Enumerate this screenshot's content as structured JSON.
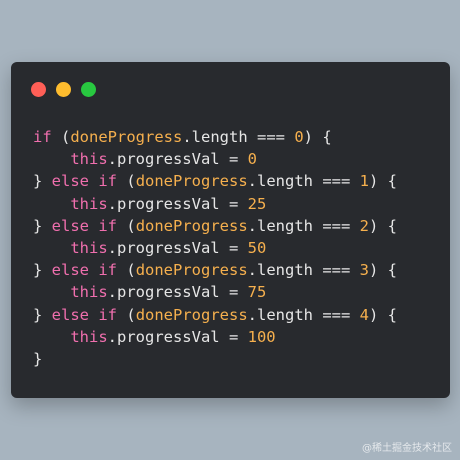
{
  "colors": {
    "background": "#a7b4bf",
    "window": "#282a2e",
    "keyword": "#f06fae",
    "identifier": "#f6b04e",
    "number": "#f6b04e",
    "plain": "#e6e6e6"
  },
  "window_controls": [
    {
      "name": "close-icon",
      "color": "#ff5f57"
    },
    {
      "name": "minimize-icon",
      "color": "#febc2e"
    },
    {
      "name": "maximize-icon",
      "color": "#28c840"
    }
  ],
  "code_lines": [
    {
      "indent": 0,
      "tokens": [
        {
          "t": "if",
          "c": "keyword"
        },
        {
          "t": " (",
          "c": "plain"
        },
        {
          "t": "doneProgress",
          "c": "identifier"
        },
        {
          "t": ".length === ",
          "c": "plain"
        },
        {
          "t": "0",
          "c": "number"
        },
        {
          "t": ") {",
          "c": "plain"
        }
      ]
    },
    {
      "indent": 1,
      "tokens": [
        {
          "t": "this",
          "c": "keyword"
        },
        {
          "t": ".progressVal = ",
          "c": "plain"
        },
        {
          "t": "0",
          "c": "number"
        }
      ]
    },
    {
      "indent": 0,
      "tokens": [
        {
          "t": "} ",
          "c": "plain"
        },
        {
          "t": "else",
          "c": "keyword"
        },
        {
          "t": " ",
          "c": "plain"
        },
        {
          "t": "if",
          "c": "keyword"
        },
        {
          "t": " (",
          "c": "plain"
        },
        {
          "t": "doneProgress",
          "c": "identifier"
        },
        {
          "t": ".length === ",
          "c": "plain"
        },
        {
          "t": "1",
          "c": "number"
        },
        {
          "t": ") {",
          "c": "plain"
        }
      ]
    },
    {
      "indent": 1,
      "tokens": [
        {
          "t": "this",
          "c": "keyword"
        },
        {
          "t": ".progressVal = ",
          "c": "plain"
        },
        {
          "t": "25",
          "c": "number"
        }
      ]
    },
    {
      "indent": 0,
      "tokens": [
        {
          "t": "} ",
          "c": "plain"
        },
        {
          "t": "else",
          "c": "keyword"
        },
        {
          "t": " ",
          "c": "plain"
        },
        {
          "t": "if",
          "c": "keyword"
        },
        {
          "t": " (",
          "c": "plain"
        },
        {
          "t": "doneProgress",
          "c": "identifier"
        },
        {
          "t": ".length === ",
          "c": "plain"
        },
        {
          "t": "2",
          "c": "number"
        },
        {
          "t": ") {",
          "c": "plain"
        }
      ]
    },
    {
      "indent": 1,
      "tokens": [
        {
          "t": "this",
          "c": "keyword"
        },
        {
          "t": ".progressVal = ",
          "c": "plain"
        },
        {
          "t": "50",
          "c": "number"
        }
      ]
    },
    {
      "indent": 0,
      "tokens": [
        {
          "t": "} ",
          "c": "plain"
        },
        {
          "t": "else",
          "c": "keyword"
        },
        {
          "t": " ",
          "c": "plain"
        },
        {
          "t": "if",
          "c": "keyword"
        },
        {
          "t": " (",
          "c": "plain"
        },
        {
          "t": "doneProgress",
          "c": "identifier"
        },
        {
          "t": ".length === ",
          "c": "plain"
        },
        {
          "t": "3",
          "c": "number"
        },
        {
          "t": ") {",
          "c": "plain"
        }
      ]
    },
    {
      "indent": 1,
      "tokens": [
        {
          "t": "this",
          "c": "keyword"
        },
        {
          "t": ".progressVal = ",
          "c": "plain"
        },
        {
          "t": "75",
          "c": "number"
        }
      ]
    },
    {
      "indent": 0,
      "tokens": [
        {
          "t": "} ",
          "c": "plain"
        },
        {
          "t": "else",
          "c": "keyword"
        },
        {
          "t": " ",
          "c": "plain"
        },
        {
          "t": "if",
          "c": "keyword"
        },
        {
          "t": " (",
          "c": "plain"
        },
        {
          "t": "doneProgress",
          "c": "identifier"
        },
        {
          "t": ".length === ",
          "c": "plain"
        },
        {
          "t": "4",
          "c": "number"
        },
        {
          "t": ") {",
          "c": "plain"
        }
      ]
    },
    {
      "indent": 1,
      "tokens": [
        {
          "t": "this",
          "c": "keyword"
        },
        {
          "t": ".progressVal = ",
          "c": "plain"
        },
        {
          "t": "100",
          "c": "number"
        }
      ]
    },
    {
      "indent": 0,
      "tokens": [
        {
          "t": "}",
          "c": "plain"
        }
      ]
    }
  ],
  "watermark": "@稀土掘金技术社区"
}
